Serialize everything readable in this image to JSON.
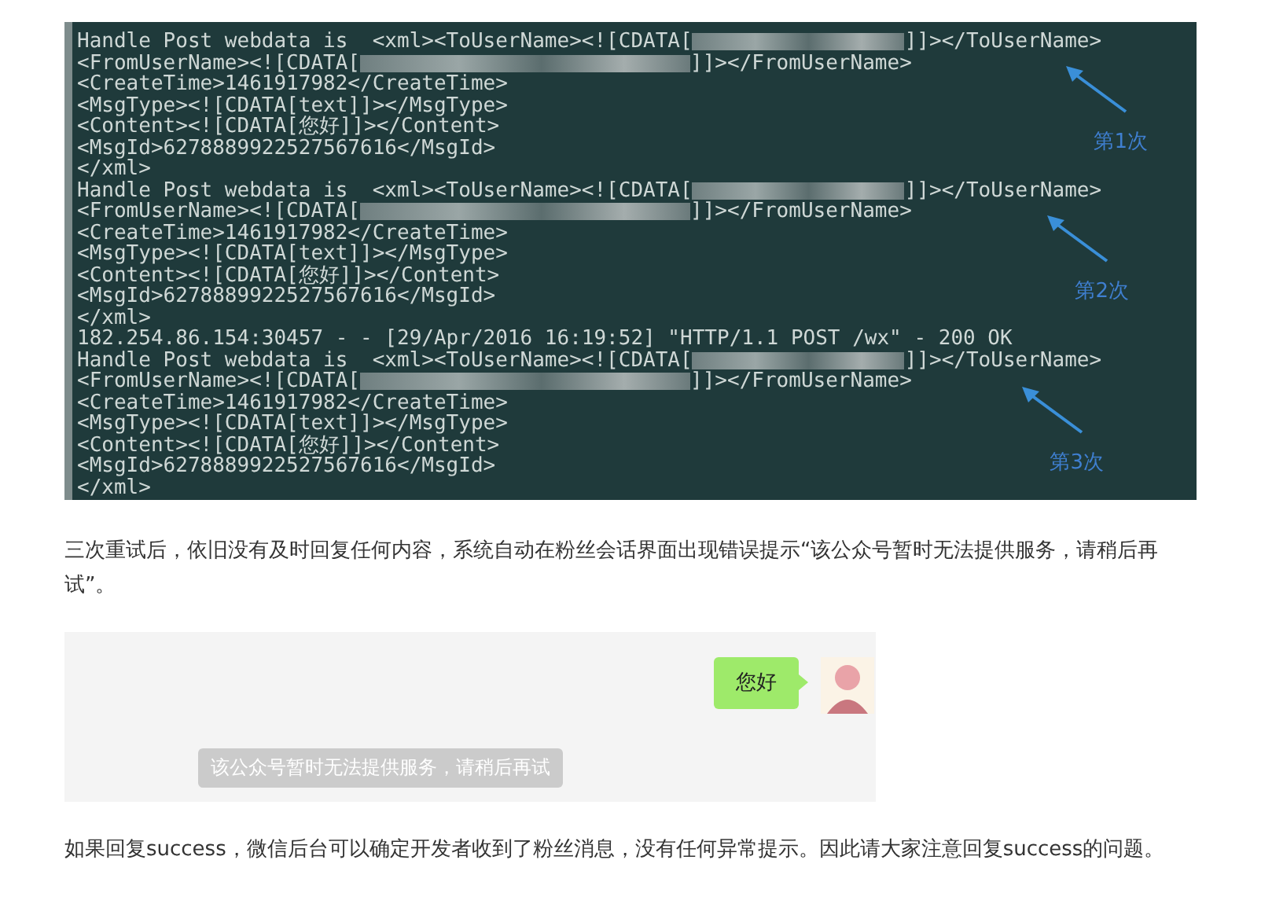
{
  "terminal": {
    "lines": [
      {
        "segments": [
          {
            "kind": "text",
            "text": "Handle Post webdata is  <xml><ToUserName><![CDATA["
          },
          {
            "kind": "blur-short"
          },
          {
            "kind": "text",
            "text": "]]></ToUserName>"
          }
        ]
      },
      {
        "segments": [
          {
            "kind": "text",
            "text": "<FromUserName><![CDATA["
          },
          {
            "kind": "blur-long"
          },
          {
            "kind": "text",
            "text": "]]></FromUserName>"
          }
        ]
      },
      {
        "segments": [
          {
            "kind": "text",
            "text": "<CreateTime>1461917982</CreateTime>"
          }
        ]
      },
      {
        "segments": [
          {
            "kind": "text",
            "text": "<MsgType><![CDATA[text]]></MsgType>"
          }
        ]
      },
      {
        "segments": [
          {
            "kind": "text",
            "text": "<Content><![CDATA[您好]]></Content>"
          }
        ]
      },
      {
        "segments": [
          {
            "kind": "text",
            "text": "<MsgId>6278889922527567616</MsgId>"
          }
        ]
      },
      {
        "segments": [
          {
            "kind": "text",
            "text": "</xml>"
          }
        ]
      },
      {
        "segments": [
          {
            "kind": "text",
            "text": "Handle Post webdata is  <xml><ToUserName><![CDATA["
          },
          {
            "kind": "blur-short"
          },
          {
            "kind": "text",
            "text": "]]></ToUserName>"
          }
        ]
      },
      {
        "segments": [
          {
            "kind": "text",
            "text": "<FromUserName><![CDATA["
          },
          {
            "kind": "blur-long"
          },
          {
            "kind": "text",
            "text": "]]></FromUserName>"
          }
        ]
      },
      {
        "segments": [
          {
            "kind": "text",
            "text": "<CreateTime>1461917982</CreateTime>"
          }
        ]
      },
      {
        "segments": [
          {
            "kind": "text",
            "text": "<MsgType><![CDATA[text]]></MsgType>"
          }
        ]
      },
      {
        "segments": [
          {
            "kind": "text",
            "text": "<Content><![CDATA[您好]]></Content>"
          }
        ]
      },
      {
        "segments": [
          {
            "kind": "text",
            "text": "<MsgId>6278889922527567616</MsgId>"
          }
        ]
      },
      {
        "segments": [
          {
            "kind": "text",
            "text": "</xml>"
          }
        ]
      },
      {
        "segments": [
          {
            "kind": "text",
            "text": "182.254.86.154:30457 - - [29/Apr/2016 16:19:52] \"HTTP/1.1 POST /wx\" - 200 OK"
          }
        ]
      },
      {
        "segments": [
          {
            "kind": "text",
            "text": "Handle Post webdata is  <xml><ToUserName><![CDATA["
          },
          {
            "kind": "blur-short"
          },
          {
            "kind": "text",
            "text": "]]></ToUserName>"
          }
        ]
      },
      {
        "segments": [
          {
            "kind": "text",
            "text": "<FromUserName><![CDATA["
          },
          {
            "kind": "blur-long"
          },
          {
            "kind": "text",
            "text": "]]></FromUserName>"
          }
        ]
      },
      {
        "segments": [
          {
            "kind": "text",
            "text": "<CreateTime>1461917982</CreateTime>"
          }
        ]
      },
      {
        "segments": [
          {
            "kind": "text",
            "text": "<MsgType><![CDATA[text]]></MsgType>"
          }
        ]
      },
      {
        "segments": [
          {
            "kind": "text",
            "text": "<Content><![CDATA[您好]]></Content>"
          }
        ]
      },
      {
        "segments": [
          {
            "kind": "text",
            "text": "<MsgId>6278889922527567616</MsgId>"
          }
        ]
      },
      {
        "segments": [
          {
            "kind": "text",
            "text": "</xml>"
          }
        ]
      }
    ],
    "annotations": [
      {
        "label": "第1次"
      },
      {
        "label": "第2次"
      },
      {
        "label": "第3次"
      }
    ]
  },
  "paragraphs": [
    "三次重试后，依旧没有及时回复任何内容，系统自动在粉丝会话界面出现错误提示“该公众号暂时无法提供服务，请稍后再试”。"
  ],
  "chat": {
    "message": "您好",
    "notice": "该公众号暂时无法提供服务，请稍后再试"
  },
  "closing": "如果回复success，微信后台可以确定开发者收到了粉丝消息，没有任何异常提示。因此请大家注意回复success的问题。"
}
